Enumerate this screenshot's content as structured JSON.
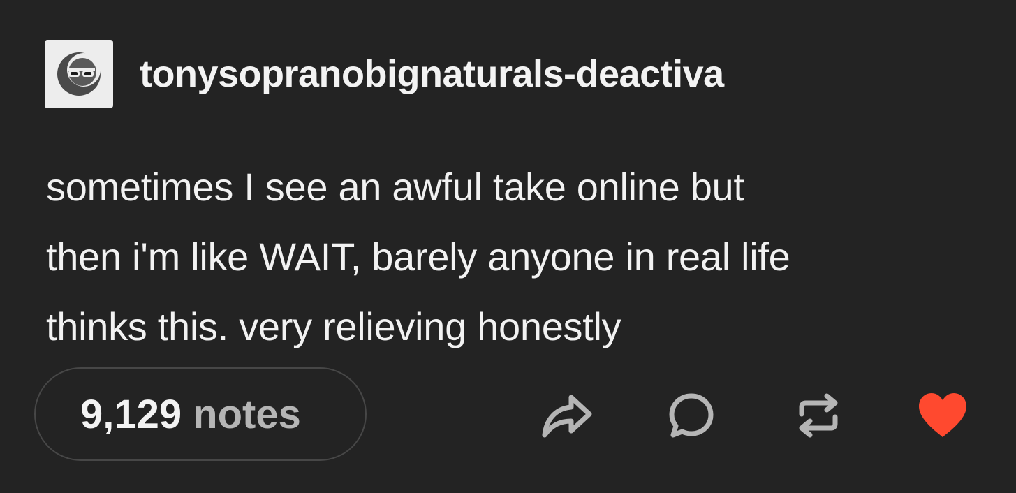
{
  "post": {
    "username": "tonysopranobignaturals-deactiva",
    "avatar_icon": "sunglasses-moon-avatar-icon",
    "body_lines": [
      "sometimes I see an awful take online but",
      "then i'm like WAIT, barely anyone in real life",
      "thinks this. very relieving honestly"
    ],
    "notes_count": "9,129",
    "notes_label": "notes"
  },
  "actions": {
    "share_icon": "share-icon",
    "reply_icon": "reply-icon",
    "reblog_icon": "reblog-icon",
    "like_icon": "heart-icon",
    "like_color": "#ff492f",
    "icon_color": "#b5b5b5"
  },
  "colors": {
    "background": "#232323",
    "text": "#f3f3f3"
  }
}
